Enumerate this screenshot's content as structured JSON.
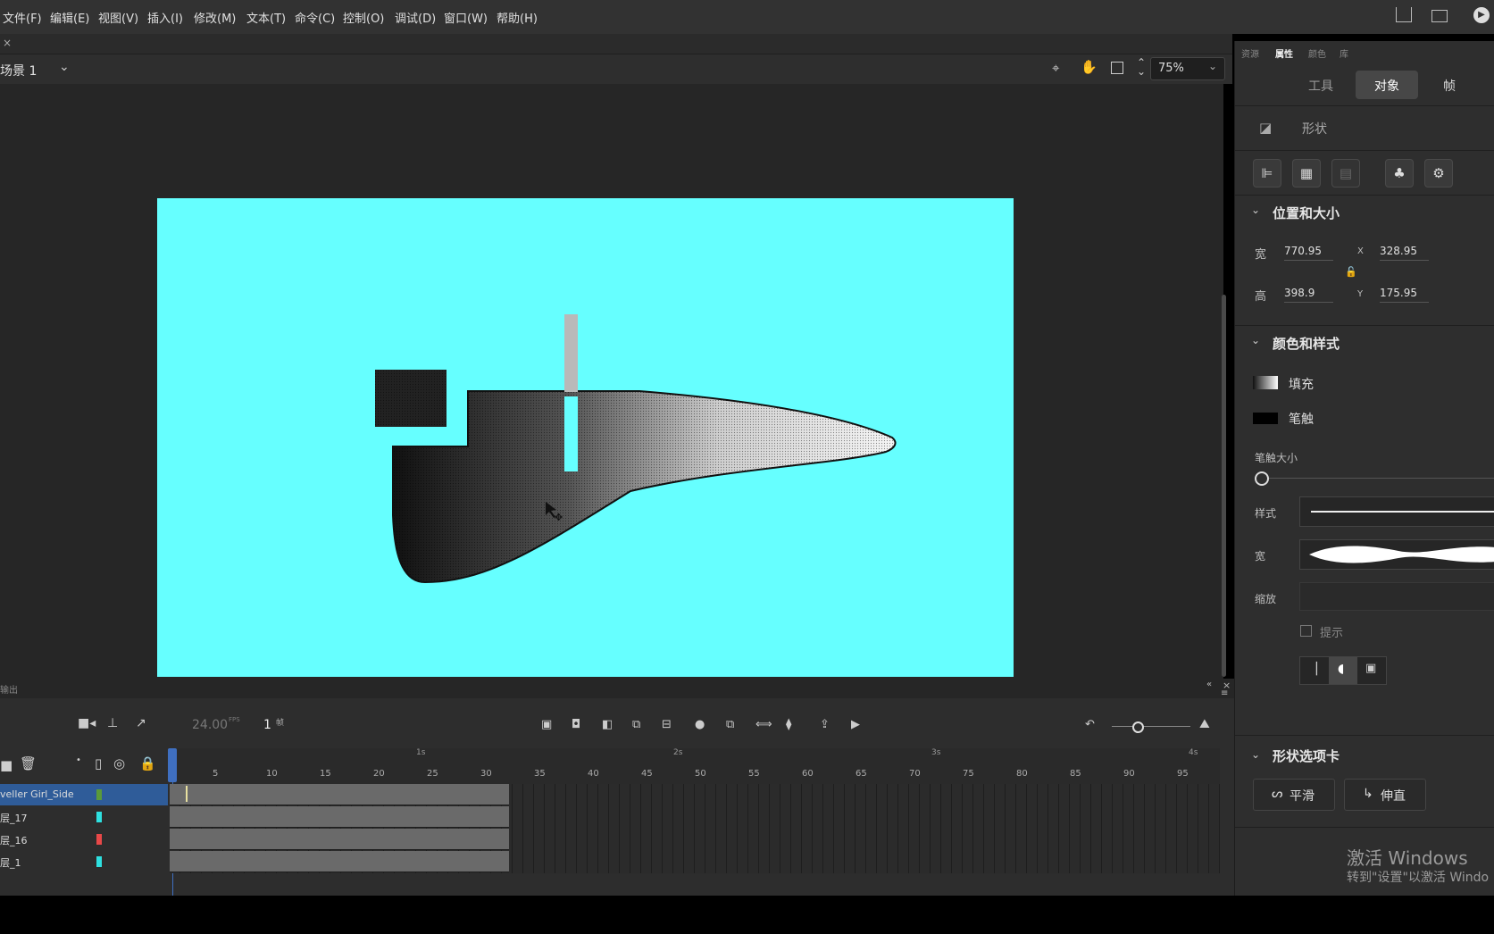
{
  "menu": [
    "文件(F)",
    "编辑(E)",
    "视图(V)",
    "插入(I)",
    "修改(M)",
    "文本(T)",
    "命令(C)",
    "控制(O)",
    "调试(D)",
    "窗口(W)",
    "帮助(H)"
  ],
  "doc_tab": {
    "close": "×"
  },
  "scene": {
    "name": "场景 1",
    "zoom": "75%"
  },
  "panel_tabs": [
    "资源",
    "属性",
    "颜色",
    "库"
  ],
  "mode_tabs": {
    "tool": "工具",
    "object": "对象",
    "frame": "帧"
  },
  "object_type": "形状",
  "position_size": {
    "title": "位置和大小",
    "width_label": "宽",
    "width": "770.95",
    "height_label": "高",
    "height": "398.9",
    "x_label": "X",
    "x": "328.95",
    "y_label": "Y",
    "y": "175.95"
  },
  "color_style": {
    "title": "颜色和样式",
    "fill_label": "填充",
    "stroke_label": "笔触",
    "stroke_size_label": "笔触大小",
    "style_label": "样式",
    "width_label": "宽",
    "scale_label": "缩放",
    "hint_label": "提示"
  },
  "shape_options": {
    "title": "形状选项卡",
    "smooth": "平滑",
    "straighten": "伸直"
  },
  "timeline": {
    "output_label": "输出",
    "fps": "24.00",
    "fps_unit": "FPS",
    "frame": "1",
    "frame_unit": "帧",
    "ruler": [
      "5",
      "10",
      "15",
      "20",
      "25",
      "30",
      "35",
      "40",
      "45",
      "50",
      "55",
      "60",
      "65",
      "70",
      "75",
      "80",
      "85",
      "90",
      "95"
    ],
    "seconds": [
      "1s",
      "2s",
      "3s",
      "4s"
    ],
    "layers": [
      {
        "name": "veller Girl_Side",
        "color": "#5a9a3a",
        "selected": true
      },
      {
        "name": "层_17",
        "color": "#2ee0e0",
        "selected": false
      },
      {
        "name": "层_16",
        "color": "#e84848",
        "selected": false
      },
      {
        "name": "层_1",
        "color": "#2ee0e0",
        "selected": false
      }
    ]
  },
  "watermark": {
    "line1": "激活 Windows",
    "line2": "转到\"设置\"以激活 Windo"
  }
}
